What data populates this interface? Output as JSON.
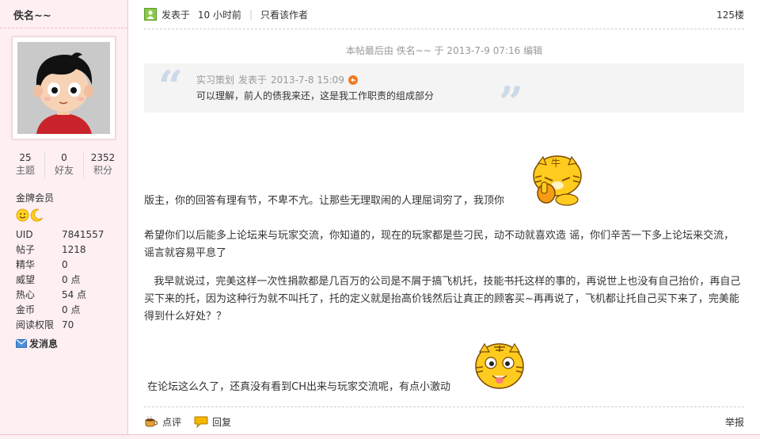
{
  "user": {
    "name": "佚名~~",
    "stats": [
      {
        "value": "25",
        "label": "主题"
      },
      {
        "value": "0",
        "label": "好友"
      },
      {
        "value": "2352",
        "label": "积分"
      }
    ],
    "group": "金牌会员",
    "info": [
      {
        "key": "UID",
        "value": "7841557"
      },
      {
        "key": "帖子",
        "value": "1218"
      },
      {
        "key": "精华",
        "value": "0"
      },
      {
        "key": "威望",
        "value": "0 点"
      },
      {
        "key": "热心",
        "value": "54 点"
      },
      {
        "key": "金币",
        "value": "0 点"
      },
      {
        "key": "阅读权限",
        "value": "70"
      }
    ],
    "send_message": "发消息"
  },
  "post": {
    "posted_label": "发表于",
    "posted_time": "10 小时前",
    "only_author": "只看该作者",
    "floor": "125楼",
    "edit_note": "本帖最后由 佚名~~ 于 2013-7-9 07:16 编辑",
    "quote": {
      "author": "实习策划",
      "posted_label": "发表于",
      "time": "2013-7-8 15:09",
      "text": "可以理解，前人的债我来还，这是我工作职责的组成部分"
    },
    "paragraphs": [
      "版主，你的回答有理有节，不卑不亢。让那些无理取闹的人理屈词穷了，我顶你",
      "希望你们以后能多上论坛来与玩家交流，你知道的，现在的玩家都是些刁民，动不动就喜欢造 谣，你们辛苦一下多上论坛来交流，谣言就容易平息了",
      "   我早就说过，完美这样一次性捐款都是几百万的公司是不屑于搞飞机托，技能书托这样的事的，再说世上也没有自己抬价，再自己买下来的托，因为这种行为就不叫托了，托的定义就是抬高价钱然后让真正的顾客买~再再说了，飞机都让托自己买下来了，完美能得到什么好处？？",
      " 在论坛这么久了，还真没有看到CH出来与玩家交流呢，有点小激动"
    ],
    "emote1_text": "牛",
    "footer": {
      "comment": "点评",
      "reply": "回复",
      "report": "举报"
    }
  },
  "colors": {
    "sidebar_bg": "#fdeff2",
    "quote_bg": "#f4f4f4",
    "quote_mark": "#cbd9e8"
  }
}
